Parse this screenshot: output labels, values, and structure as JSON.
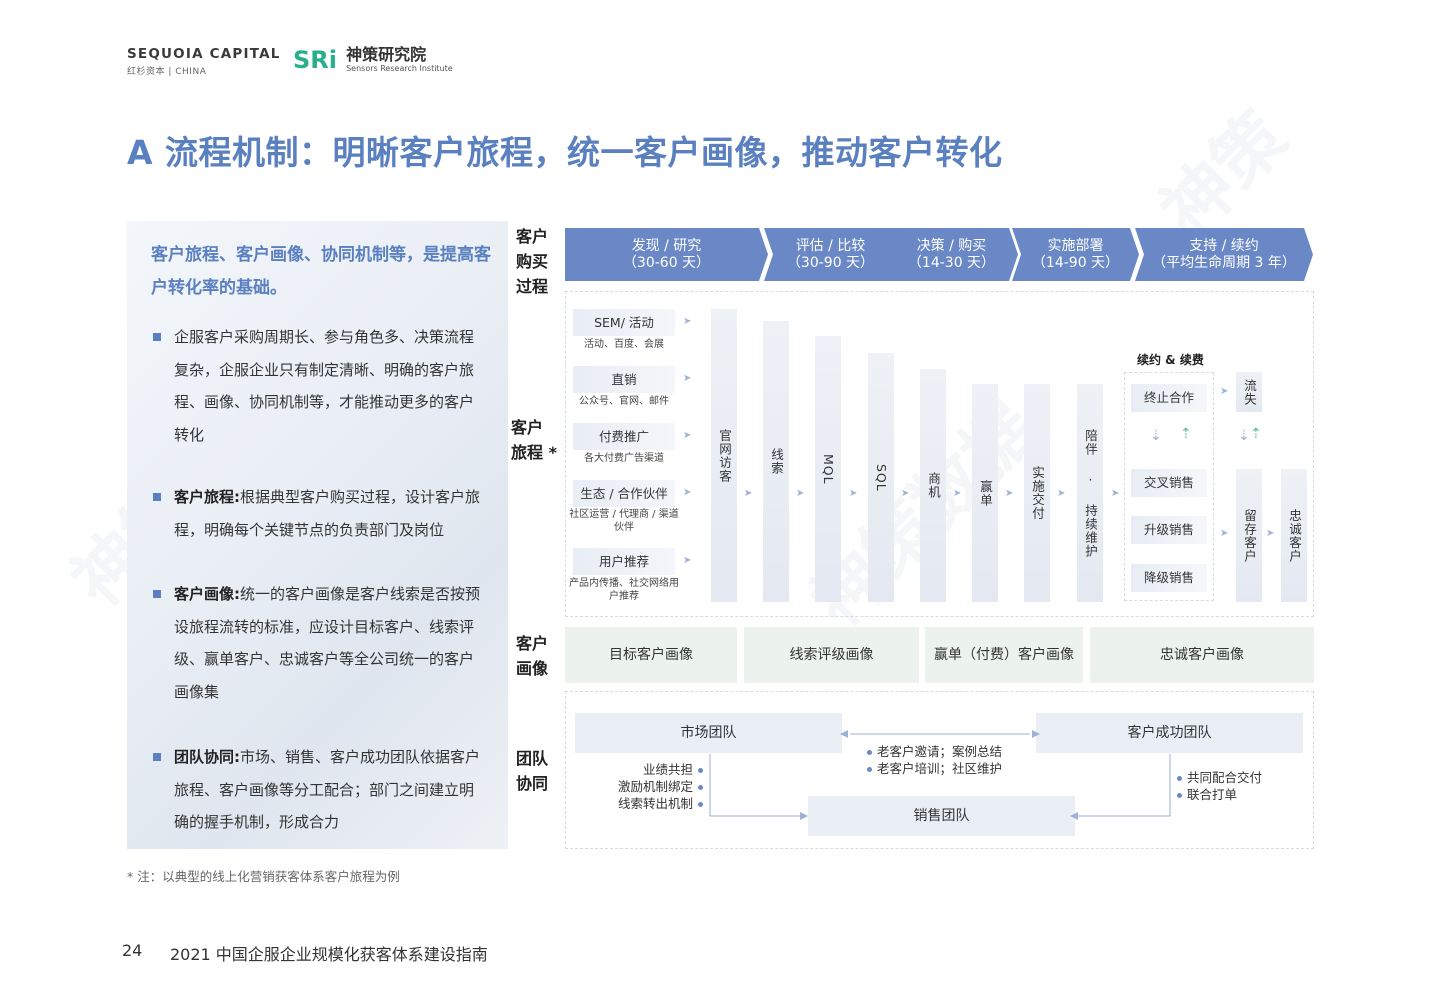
{
  "header": {
    "sequoia_name": "SEQUOIA CAPITAL",
    "sequoia_sub": "红杉资本 | CHINA",
    "sri_mark": "SRi",
    "sri_cn": "神策研究院",
    "sri_en": "Sensors Research Institute"
  },
  "title": "A 流程机制：明晰客户旅程，统一客户画像，推动客户转化",
  "left": {
    "lead": "客户旅程、客户画像、协同机制等，是提高客户转化率的基础。",
    "bullets": [
      {
        "label": "",
        "text": "企服客户采购周期长、参与角色多、决策流程复杂，企服企业只有制定清晰、明确的客户旅程、画像、协同机制等，才能推动更多的客户转化"
      },
      {
        "label": "客户旅程:",
        "text": "根据典型客户购买过程，设计客户旅程，明确每个关键节点的负责部门及岗位"
      },
      {
        "label": "客户画像:",
        "text": "统一的客户画像是客户线索是否按预设旅程流转的标准，应设计目标客户、线索评级、赢单客户、忠诚客户等全公司统一的客户画像集"
      },
      {
        "label": "团队协同:",
        "text": "市场、销售、客户成功团队依据客户旅程、客户画像等分工配合；部门之间建立明确的握手机制，形成合力"
      }
    ]
  },
  "row_labels": {
    "buy": "客户\n购买\n过程",
    "journey": "客户\n旅程 *",
    "profile": "客户\n画像",
    "team": "团队\n协同"
  },
  "stages": [
    {
      "name": "发现 / 研究",
      "period": "（30-60 天）"
    },
    {
      "name": "评估 / 比较",
      "period": "（30-90 天）"
    },
    {
      "name": "决策 / 购买",
      "period": "（14-30 天）"
    },
    {
      "name": "实施部署",
      "period": "（14-90 天）"
    },
    {
      "name": "支持 / 续约",
      "period": "（平均生命周期 3 年）"
    }
  ],
  "sources": [
    {
      "name": "SEM/ 活动",
      "sub": "活动、百度、会展"
    },
    {
      "name": "直销",
      "sub": "公众号、官网、邮件"
    },
    {
      "name": "付费推广",
      "sub": "各大付费广告渠道"
    },
    {
      "name": "生态 / 合作伙伴",
      "sub": "社区运营 / 代理商 / 渠道伙伴"
    },
    {
      "name": "用户推荐",
      "sub": "产品内传播、社交网络用户推荐"
    }
  ],
  "funnel": [
    "官网访客",
    "线索",
    "MQL",
    "SQL",
    "商机",
    "赢单",
    "实施交付",
    "陪伴 · 持续维护"
  ],
  "renewal": {
    "title": "续约 & 续费",
    "items": [
      "终止合作",
      "交叉销售",
      "升级销售",
      "降级销售"
    ],
    "churn": "流失",
    "retain": "留存客户",
    "loyal": "忠诚客户"
  },
  "profiles": [
    "目标客户画像",
    "线索评级画像",
    "赢单（付费）客户画像",
    "忠诚客户画像"
  ],
  "teams": {
    "market": "市场团队",
    "success": "客户成功团队",
    "sales": "销售团队",
    "mid_notes": [
      "老客户邀请；案例总结",
      "老客户培训；社区维护"
    ],
    "left_notes": [
      "业绩共担",
      "激励机制绑定",
      "线索转出机制"
    ],
    "right_notes": [
      "共同配合交付",
      "联合打单"
    ]
  },
  "footnote": "* 注：以典型的线上化营销获客体系客户旅程为例",
  "footer": {
    "page": "24",
    "doc_title": "2021 中国企服企业规模化获客体系建设指南"
  },
  "colors": {
    "accent": "#5a80c0",
    "stage_bg": "#6b88c6",
    "profile_bg": "#ecf3ef",
    "sri_green": "#28b08c"
  }
}
